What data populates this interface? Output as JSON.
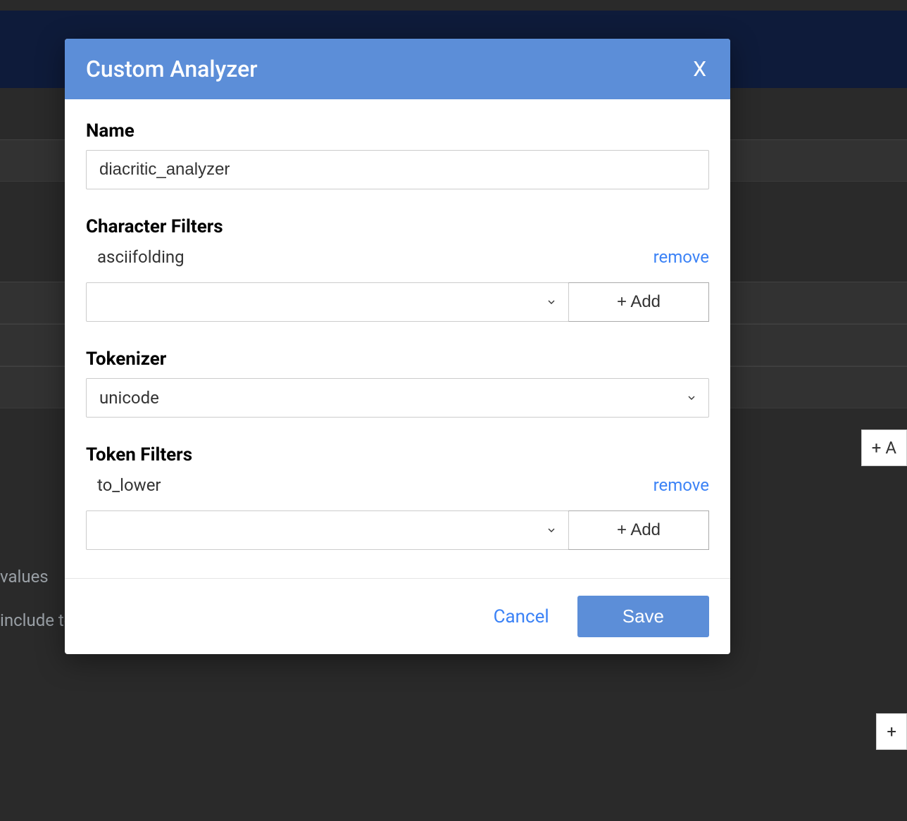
{
  "modal": {
    "title": "Custom Analyzer",
    "close_label": "X",
    "name": {
      "label": "Name",
      "value": "diacritic_analyzer"
    },
    "char_filters": {
      "label": "Character Filters",
      "items": [
        {
          "name": "asciifolding",
          "remove_label": "remove"
        }
      ],
      "select_value": "",
      "add_label": "+ Add"
    },
    "tokenizer": {
      "label": "Tokenizer",
      "value": "unicode"
    },
    "token_filters": {
      "label": "Token Filters",
      "items": [
        {
          "name": "to_lower",
          "remove_label": "remove"
        }
      ],
      "select_value": "",
      "add_label": "+ Add"
    },
    "footer": {
      "cancel_label": "Cancel",
      "save_label": "Save"
    }
  },
  "background": {
    "text1": "values",
    "text2": "include te",
    "add_btn1": "+ A",
    "add_btn2": "+"
  }
}
